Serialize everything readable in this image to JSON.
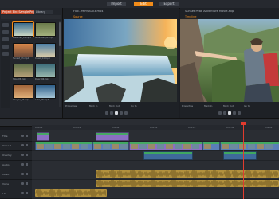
{
  "modes": {
    "import": "Import",
    "edit": "Edit",
    "export": "Export"
  },
  "library": {
    "tabs": [
      "Project Bin: Sample Proj",
      "Library"
    ],
    "items": [
      {
        "label": "Waterfall_01.mp4",
        "color1": "#3a6b8c",
        "color2": "#c9d6c3"
      },
      {
        "label": "Mountain_02.mp4",
        "color1": "#6a7a4a",
        "color2": "#a3b07d"
      },
      {
        "label": "Sunset_03.mp4",
        "color1": "#d9884a",
        "color2": "#6d4a3a"
      },
      {
        "label": "Coast_04.mp4",
        "color1": "#4d7fa6",
        "color2": "#d6c9a8"
      },
      {
        "label": "Hike_05.mp4",
        "color1": "#5f6f4a",
        "color2": "#b8a27a"
      },
      {
        "label": "River_06.mp4",
        "color1": "#3f6f7c",
        "color2": "#9bb9b0"
      },
      {
        "label": "Canyon_07.mp4",
        "color1": "#a2653a",
        "color2": "#e0b07a"
      },
      {
        "label": "Lake_08.mp4",
        "color1": "#2f5f8a",
        "color2": "#a6c6d6"
      }
    ]
  },
  "source_player": {
    "title": "FILE-9999/A003.mp4",
    "tab": "Source"
  },
  "timeline_player": {
    "title": "Sunset Peak Adventure Movie.axp",
    "tab": "Timeline"
  },
  "player_tabs": [
    "Properties",
    "Mark In",
    "Mark Out",
    "Go to"
  ],
  "tracks": [
    {
      "label": "Title"
    },
    {
      "label": "Video 1"
    },
    {
      "label": "Overlay"
    },
    {
      "label": "Audio"
    },
    {
      "label": "Music"
    },
    {
      "label": "Voice"
    },
    {
      "label": "FX"
    }
  ],
  "ruler": [
    "0:00:00",
    "0:00:20",
    "0:00:40",
    "0:01:00",
    "0:01:20",
    "0:01:40",
    "0:02:00"
  ],
  "colors": {
    "accent": "#f28c1a",
    "clip_video": "#5a7fb8",
    "clip_title": "#8a6fc2",
    "clip_green": "#3fae5a",
    "audio": "#b2913e",
    "playhead": "#e23b2e"
  }
}
